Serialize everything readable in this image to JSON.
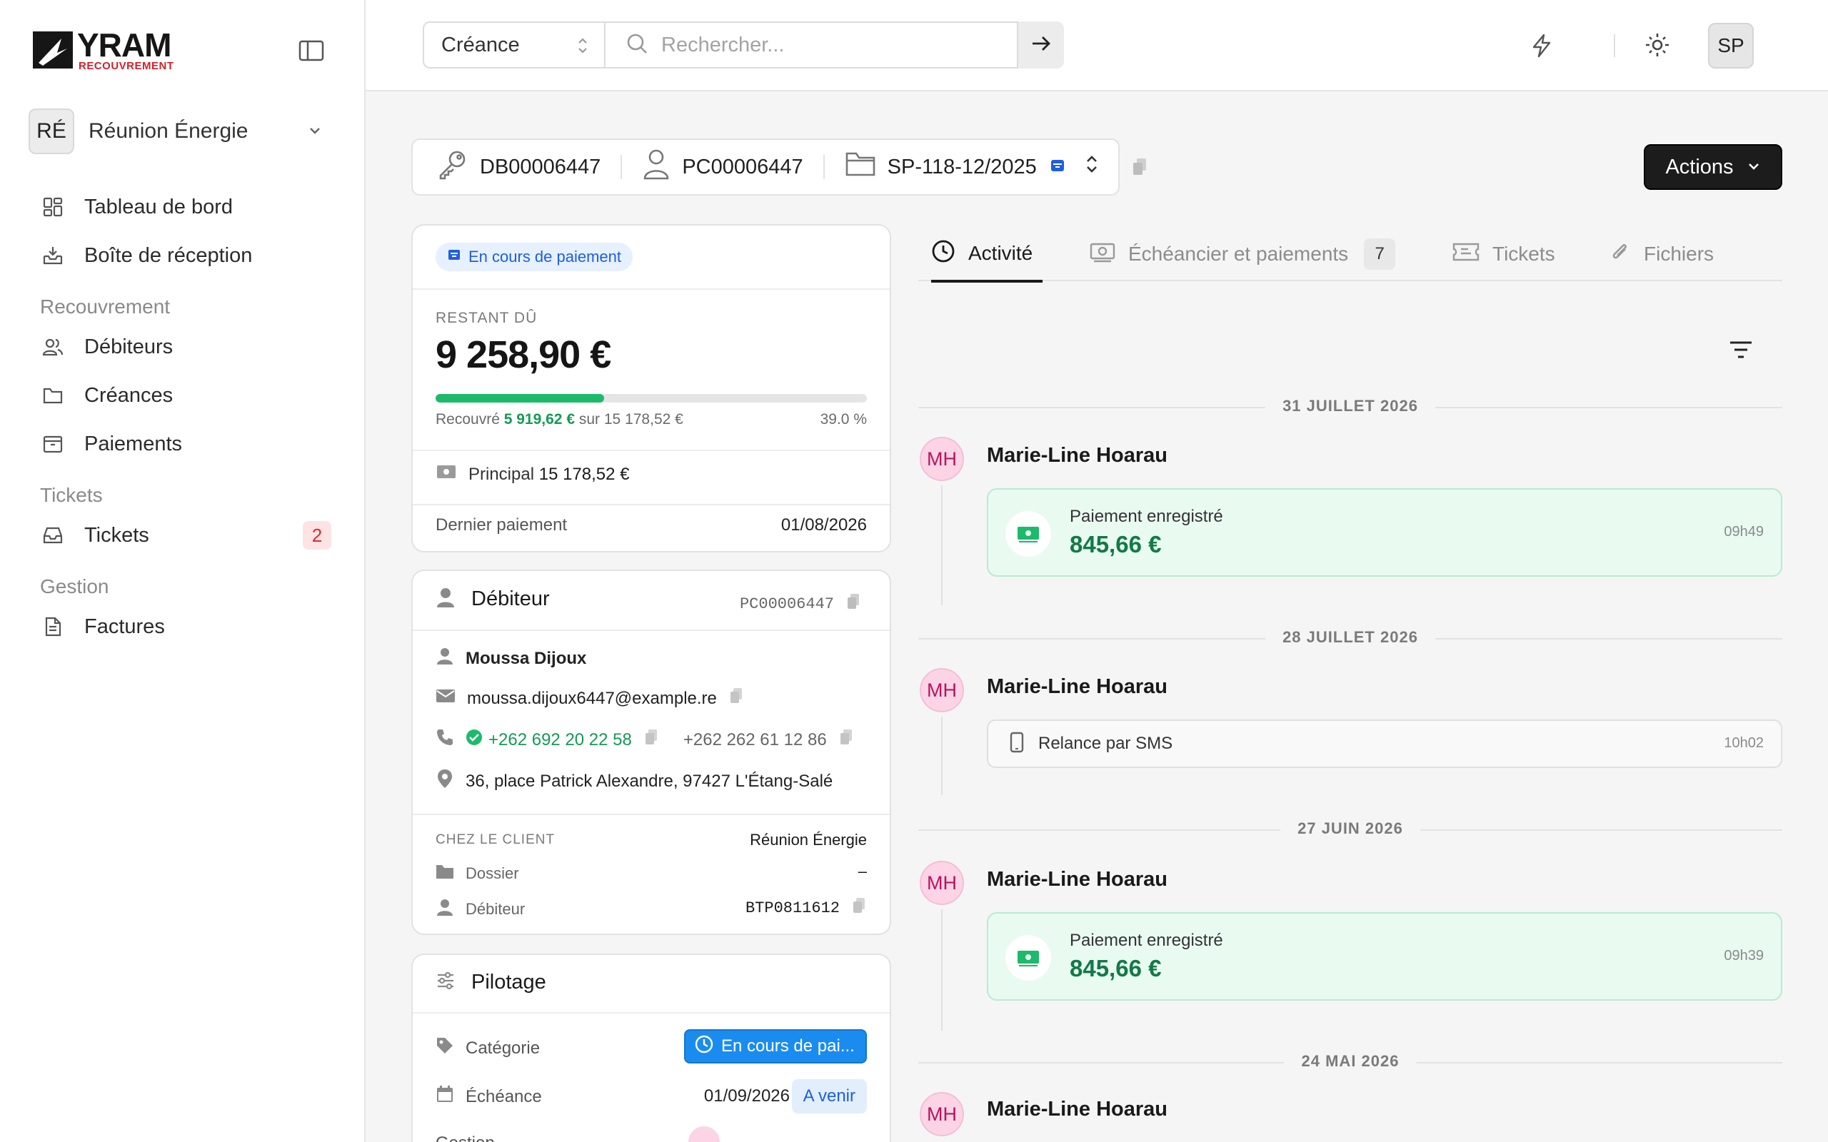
{
  "brand": {
    "name": "YRAM",
    "tagline": "RECOUVREMENT"
  },
  "org": {
    "initials": "RÉ",
    "name": "Réunion Énergie"
  },
  "sidebar": {
    "items": [
      {
        "label": "Tableau de bord",
        "icon": "dashboard-icon"
      },
      {
        "label": "Boîte de réception",
        "icon": "inbox-icon"
      }
    ],
    "sections": [
      {
        "title": "Recouvrement",
        "items": [
          {
            "label": "Débiteurs",
            "icon": "users-icon"
          },
          {
            "label": "Créances",
            "icon": "folder-icon"
          },
          {
            "label": "Paiements",
            "icon": "wallet-icon"
          }
        ]
      },
      {
        "title": "Tickets",
        "items": [
          {
            "label": "Tickets",
            "icon": "tray-icon",
            "badge": "2"
          }
        ]
      },
      {
        "title": "Gestion",
        "items": [
          {
            "label": "Factures",
            "icon": "file-icon"
          }
        ]
      }
    ]
  },
  "topbar": {
    "scope": "Créance",
    "search_placeholder": "Rechercher...",
    "user_initials": "SP"
  },
  "refbar": {
    "debtor_id": "DB00006447",
    "person_id": "PC00006447",
    "file_id": "SP-118-12/2025"
  },
  "actions_label": "Actions",
  "summary": {
    "status": "En cours de paiement",
    "remaining_label": "RESTANT DÛ",
    "remaining_amount": "9 258,90 €",
    "progress_fraction": 0.39,
    "recovered_prefix": "Recouvré",
    "recovered_amount": "5 919,62 €",
    "recovered_mid": "sur",
    "total_amount": "15 178,52 €",
    "percent": "39.0 %",
    "principal_label": "Principal",
    "principal_amount": "15 178,52 €",
    "last_payment_label": "Dernier paiement",
    "last_payment_date": "01/08/2026"
  },
  "debtor": {
    "title": "Débiteur",
    "ref": "PC00006447",
    "name": "Moussa Dijoux",
    "email": "moussa.dijoux6447@example.re",
    "phone_verified": "+262 692 20 22 58",
    "phone_alt": "+262 262 61 12 86",
    "address": "36, place Patrick Alexandre, 97427 L'Étang-Salé",
    "client_label": "CHEZ LE CLIENT",
    "client_name": "Réunion Énergie",
    "dossier_label": "Dossier",
    "dossier_value": "–",
    "debiteur_label": "Débiteur",
    "debiteur_value": "BTP0811612"
  },
  "pilotage": {
    "title": "Pilotage",
    "category_label": "Catégorie",
    "category_value": "En cours de pai...",
    "due_label": "Échéance",
    "due_date": "01/09/2026",
    "due_badge": "A venir",
    "manager_label": "Gestion"
  },
  "tabs": [
    {
      "label": "Activité",
      "active": true
    },
    {
      "label": "Échéancier et paiements",
      "count": "7"
    },
    {
      "label": "Tickets"
    },
    {
      "label": "Fichiers"
    }
  ],
  "activity": [
    {
      "date": "31 JUILLET 2026",
      "user": "Marie-Line Hoarau",
      "initials": "MH",
      "type": "payment",
      "label": "Paiement enregistré",
      "amount": "845,66 €",
      "time": "09h49"
    },
    {
      "date": "28 JUILLET 2026",
      "user": "Marie-Line Hoarau",
      "initials": "MH",
      "type": "sms",
      "label": "Relance par SMS",
      "time": "10h02"
    },
    {
      "date": "27 JUIN 2026",
      "user": "Marie-Line Hoarau",
      "initials": "MH",
      "type": "payment",
      "label": "Paiement enregistré",
      "amount": "845,66 €",
      "time": "09h39"
    },
    {
      "date": "24 MAI 2026",
      "user": "Marie-Line Hoarau",
      "initials": "MH"
    }
  ],
  "colors": {
    "accent_green": "#127a45",
    "status_blue": "#1d5fe0",
    "badge_red": "#d92d2d"
  }
}
